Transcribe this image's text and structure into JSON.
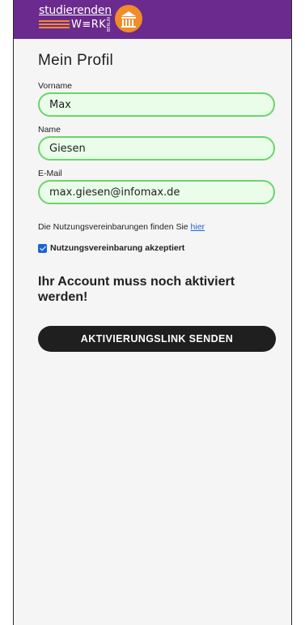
{
  "brand": {
    "line1": "studierenden",
    "line2": "W≡RK",
    "city": "BERLIN",
    "badge_color": "#f28c28",
    "bar_color": "#6b2a8e"
  },
  "page": {
    "title": "Mein Profil"
  },
  "form": {
    "first_name": {
      "label": "Vorname",
      "value": "Max"
    },
    "last_name": {
      "label": "Name",
      "value": "Giesen"
    },
    "email": {
      "label": "E-Mail",
      "value": "max.giesen@infomax.de"
    }
  },
  "terms": {
    "text": "Die Nutzungsvereinbarungen finden Sie ",
    "link": "hier",
    "checkbox_label": "Nutzungsvereinbarung akzeptiert",
    "checked": true
  },
  "notice": "Ihr Account muss noch aktiviert werden!",
  "action": {
    "label": "AKTIVIERUNGSLINK SENDEN"
  }
}
